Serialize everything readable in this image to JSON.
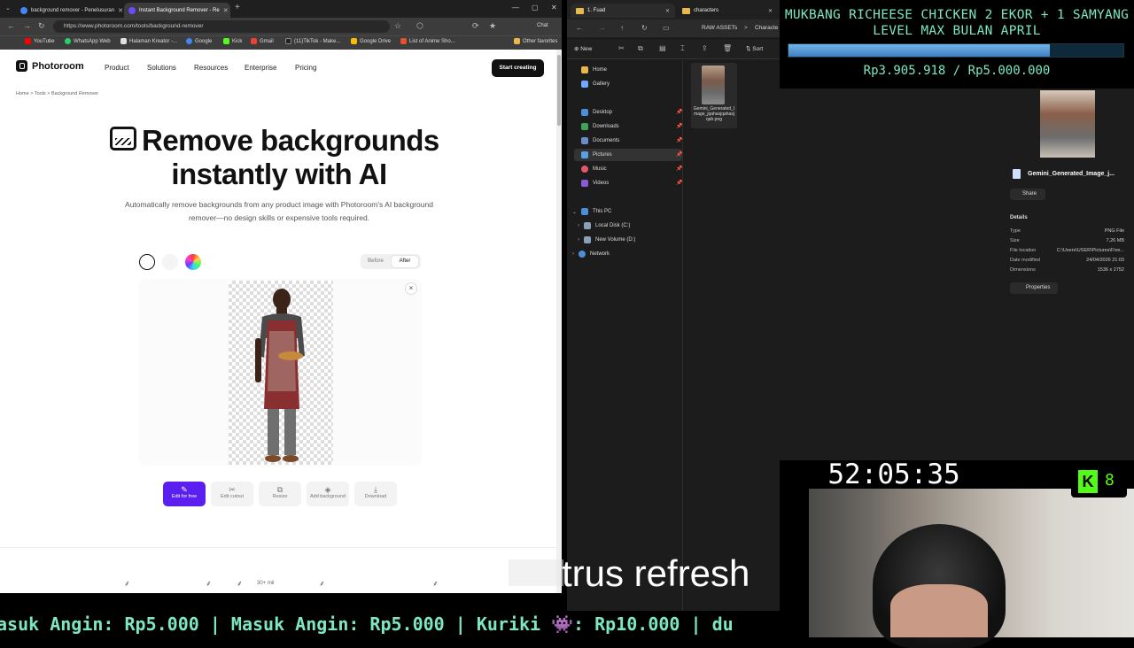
{
  "browser": {
    "tabs": [
      {
        "title": "background remover - Penelusuran",
        "color": "#4285f4"
      },
      {
        "title": "Instant Background Remover - Re",
        "color": "#6d4cff"
      }
    ],
    "url": "https://www.photoroom.com/tools/background-remover",
    "chat_label": "Chat",
    "bookmarks": [
      {
        "label": "YouTube",
        "color": "#ff0000"
      },
      {
        "label": "WhatsApp Web",
        "color": "#25d366"
      },
      {
        "label": "Halaman Kreator -...",
        "color": "#e0e0e0"
      },
      {
        "label": "Google",
        "color": "#4285f4"
      },
      {
        "label": "Kick",
        "color": "#53fc18"
      },
      {
        "label": "Gmail",
        "color": "#ea4335"
      },
      {
        "label": "(11)TikTok - Make...",
        "color": "#222222"
      },
      {
        "label": "Google Drive",
        "color": "#fbbc04"
      },
      {
        "label": "List of Anime Sho...",
        "color": "#e2522b"
      },
      {
        "label": "Other favorites",
        "color": "#e8b84a"
      }
    ]
  },
  "page": {
    "brand": "Photoroom",
    "nav": [
      "Product",
      "Solutions",
      "Resources",
      "Enterprise",
      "Pricing"
    ],
    "cta": "Start creating",
    "breadcrumb": "Home  >  Tools  >  Background Remover",
    "title_line1": "Remove backgrounds",
    "title_line2": "instantly with AI",
    "subtitle": "Automatically remove backgrounds from any product image with Photoroom's AI background remover—no design skills or expensive tools required.",
    "toggle": {
      "before": "Before",
      "after": "After"
    },
    "close": "×",
    "tools": [
      {
        "label": "Edit for free",
        "icon": "✎"
      },
      {
        "label": "Edit cutout",
        "icon": "✂"
      },
      {
        "label": "Resize",
        "icon": "⧉"
      },
      {
        "label": "Add background",
        "icon": "◈"
      },
      {
        "label": "Download",
        "icon": "⤓"
      }
    ],
    "stat_fragment": "30+ mil"
  },
  "explorer": {
    "tabs": [
      "1. Fuad",
      "characters"
    ],
    "path": [
      "RAW ASSETs",
      ">",
      "Characte"
    ],
    "new_label": "New",
    "sort_label": "Sort",
    "sidebar": [
      {
        "label": "Home",
        "color": "#e8b84a"
      },
      {
        "label": "Gallery",
        "color": "#6fa8ff"
      },
      {
        "label": "Desktop",
        "color": "#4a8fd8"
      },
      {
        "label": "Downloads",
        "color": "#3fa35a"
      },
      {
        "label": "Documents",
        "color": "#6a8cc7"
      },
      {
        "label": "Pictures",
        "color": "#5aa0e6"
      },
      {
        "label": "Music",
        "color": "#e5566b"
      },
      {
        "label": "Videos",
        "color": "#8a5ad8"
      }
    ],
    "tree": [
      "This PC",
      "Local Disk (C:)",
      "New Volume (D:)",
      "Network"
    ],
    "file_name": "Gemini_Generated_Image_jqahasjqahasjqah.png",
    "details": {
      "name": "Gemini_Generated_Image_j...",
      "share": "Share",
      "heading": "Details",
      "rows": [
        {
          "k": "Type",
          "v": "PNG File"
        },
        {
          "k": "Size",
          "v": "7,26 MB"
        },
        {
          "k": "File location",
          "v": "C:\\Users\\USER\\Pictures\\Five..."
        },
        {
          "k": "Date modified",
          "v": "24/04/2026 21:03"
        },
        {
          "k": "Dimensions",
          "v": "1536 x 2752"
        }
      ],
      "properties": "Properties"
    }
  },
  "stream": {
    "goal_title": "MUKBANG RICHEESE CHICKEN 2 EKOR + 1 SAMYANG LEVEL MAX BULAN APRIL",
    "goal_amount": "Rp3.905.918 / Rp5.000.000",
    "goal_progress": 0.78,
    "timer": "52:05:35",
    "kick_count": "8",
    "subtitle": "trus refresh",
    "ticker": "asuk Angin: Rp5.000 | Masuk Angin: Rp5.000 | Kuriki 👾: Rp10.000 | du"
  },
  "colors": {
    "accent": "#5b1ff0",
    "goal_text": "#7de7c4",
    "kick_green": "#53fc18"
  }
}
